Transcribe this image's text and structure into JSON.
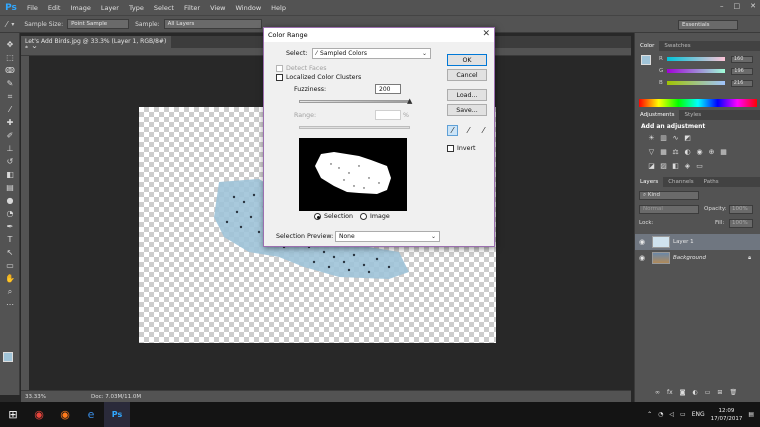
{
  "app": {
    "logo": "Ps",
    "menu": [
      "File",
      "Edit",
      "Image",
      "Layer",
      "Type",
      "Select",
      "Filter",
      "View",
      "Window",
      "Help"
    ],
    "window_controls": [
      "–",
      "□",
      "✕"
    ]
  },
  "options_bar": {
    "sample_size_label": "Sample Size:",
    "sample_size_value": "Point Sample",
    "sample_label": "Sample:",
    "sample_value": "All Layers",
    "workspace": "Essentials"
  },
  "document": {
    "tab_title": "Let's Add Birds.jpg @ 33.3% (Layer 1, RGB/8#) *",
    "zoom": "33.33%",
    "doc_size": "Doc: 7.03M/11.0M"
  },
  "color_panel": {
    "tabs": [
      "Color",
      "Swatches"
    ],
    "channels": [
      {
        "label": "R",
        "value": "160"
      },
      {
        "label": "G",
        "value": "196"
      },
      {
        "label": "B",
        "value": "216"
      }
    ]
  },
  "adjustments_panel": {
    "tabs": [
      "Adjustments",
      "Styles"
    ],
    "title": "Add an adjustment"
  },
  "layers_panel": {
    "tabs": [
      "Layers",
      "Channels",
      "Paths"
    ],
    "kind_label": "Kind",
    "blend_mode": "Normal",
    "opacity_label": "Opacity:",
    "opacity_value": "100%",
    "lock_label": "Lock:",
    "fill_label": "Fill:",
    "fill_value": "100%",
    "layers": [
      {
        "name": "Layer 1",
        "selected": true
      },
      {
        "name": "Background",
        "selected": false
      }
    ]
  },
  "dialog": {
    "title": "Color Range",
    "select_label": "Select:",
    "select_value": "Sampled Colors",
    "detect_faces": "Detect Faces",
    "localized_clusters": "Localized Color Clusters",
    "fuzziness_label": "Fuzziness:",
    "fuzziness_value": "200",
    "fuzziness_fraction": 1.0,
    "range_label": "Range:",
    "range_unit": "%",
    "radio_selection": "Selection",
    "radio_image": "Image",
    "preview_label": "Selection Preview:",
    "preview_value": "None",
    "buttons": {
      "ok": "OK",
      "cancel": "Cancel",
      "load": "Load...",
      "save": "Save..."
    },
    "invert_label": "Invert"
  },
  "taskbar": {
    "language": "ENG",
    "time": "12:09",
    "date": "17/07/2017"
  },
  "colors": {
    "foreground": "#a0c4d8",
    "background": "#ffffff",
    "dialog_border": "#9b6fb0",
    "ps_blue": "#31a8ff"
  }
}
